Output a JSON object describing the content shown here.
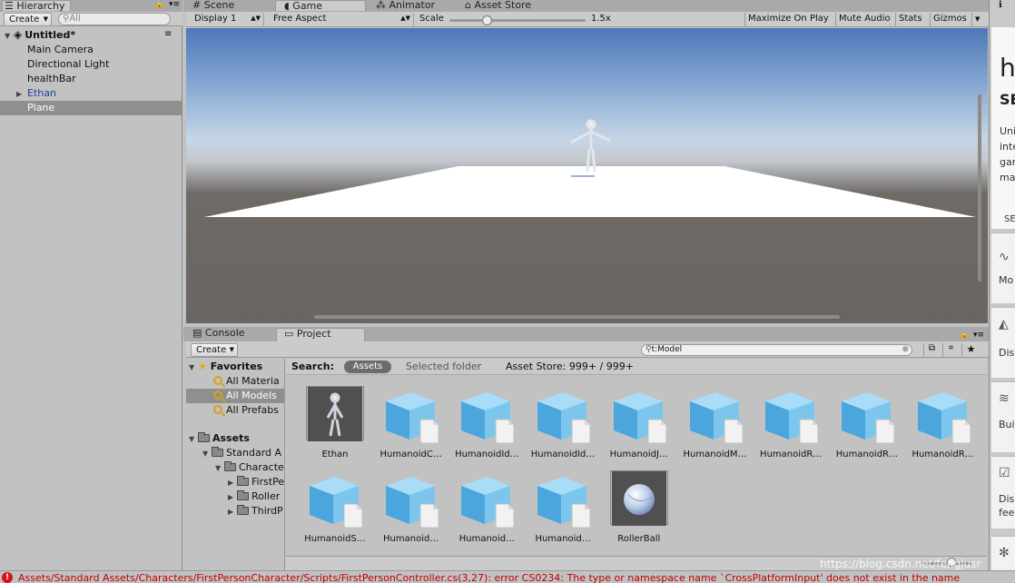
{
  "hierarchy": {
    "tab_label": "Hierarchy",
    "create_label": "Create",
    "search_placeholder": "All",
    "scene_name": "Untitled*",
    "items": [
      {
        "label": "Main Camera"
      },
      {
        "label": "Directional Light"
      },
      {
        "label": "healthBar"
      },
      {
        "label": "Ethan"
      },
      {
        "label": "Plane"
      }
    ]
  },
  "top_tabs": {
    "scene": "Scene",
    "game": "Game",
    "animator": "Animator",
    "asset_store": "Asset Store"
  },
  "game_toolbar": {
    "display": "Display 1",
    "aspect": "Free Aspect",
    "scale_label": "Scale",
    "scale_value": "1.5x",
    "scale_fraction": 0.27,
    "maximize": "Maximize On Play",
    "mute": "Mute Audio",
    "stats": "Stats",
    "gizmos": "Gizmos"
  },
  "bottom_tabs": {
    "console": "Console",
    "project": "Project"
  },
  "project": {
    "create_label": "Create",
    "search_value": "t:Model",
    "search_label": "Search:",
    "scope_assets": "Assets",
    "scope_selected": "Selected folder",
    "asset_store_count": "Asset Store: 999+ / 999+",
    "favorites_label": "Favorites",
    "favorites": [
      {
        "label": "All Materia"
      },
      {
        "label": "All Models"
      },
      {
        "label": "All Prefabs"
      }
    ],
    "assets_label": "Assets",
    "folders": [
      {
        "label": "Standard A"
      },
      {
        "label": "Characte"
      },
      {
        "label": "FirstPe"
      },
      {
        "label": "Roller"
      },
      {
        "label": "ThirdP"
      }
    ],
    "assets": [
      {
        "label": "Ethan",
        "type": "figure"
      },
      {
        "label": "HumanoidC…",
        "type": "cube"
      },
      {
        "label": "HumanoidId…",
        "type": "cube"
      },
      {
        "label": "HumanoidId…",
        "type": "cube"
      },
      {
        "label": "HumanoidJ…",
        "type": "cube"
      },
      {
        "label": "HumanoidM…",
        "type": "cube"
      },
      {
        "label": "HumanoidR…",
        "type": "cube"
      },
      {
        "label": "HumanoidR…",
        "type": "cube"
      },
      {
        "label": "HumanoidR…",
        "type": "cube"
      },
      {
        "label": "HumanoidS…",
        "type": "cube"
      },
      {
        "label": "Humanoid…",
        "type": "cube"
      },
      {
        "label": "Humanoid…",
        "type": "cube"
      },
      {
        "label": "Humanoid…",
        "type": "cube"
      },
      {
        "label": "RollerBall",
        "type": "sphere"
      }
    ]
  },
  "right_panel": {
    "heading": "he",
    "subheading": "SE",
    "body_lines": [
      "Uni",
      "inte",
      "gam",
      "mar"
    ],
    "button": "SE",
    "items": [
      {
        "label": "Mo"
      },
      {
        "label": "Dis"
      },
      {
        "label": "Bui"
      },
      {
        "label": "Dis",
        "extra": "fee"
      }
    ]
  },
  "status": {
    "error": "Assets/Standard Assets/Characters/FirstPersonCharacter/Scripts/FirstPersonController.cs(3,27): error CS0234: The type or namespace name `CrossPlatformInput' does not exist in the name",
    "watermark": "https://blog.csdn.net/fengjusr"
  },
  "colors": {
    "selection": "#8f8f8f",
    "accent_blue": "#5fb3e6",
    "error_red": "#c00000",
    "scope_pill": "#6c6c6c"
  }
}
